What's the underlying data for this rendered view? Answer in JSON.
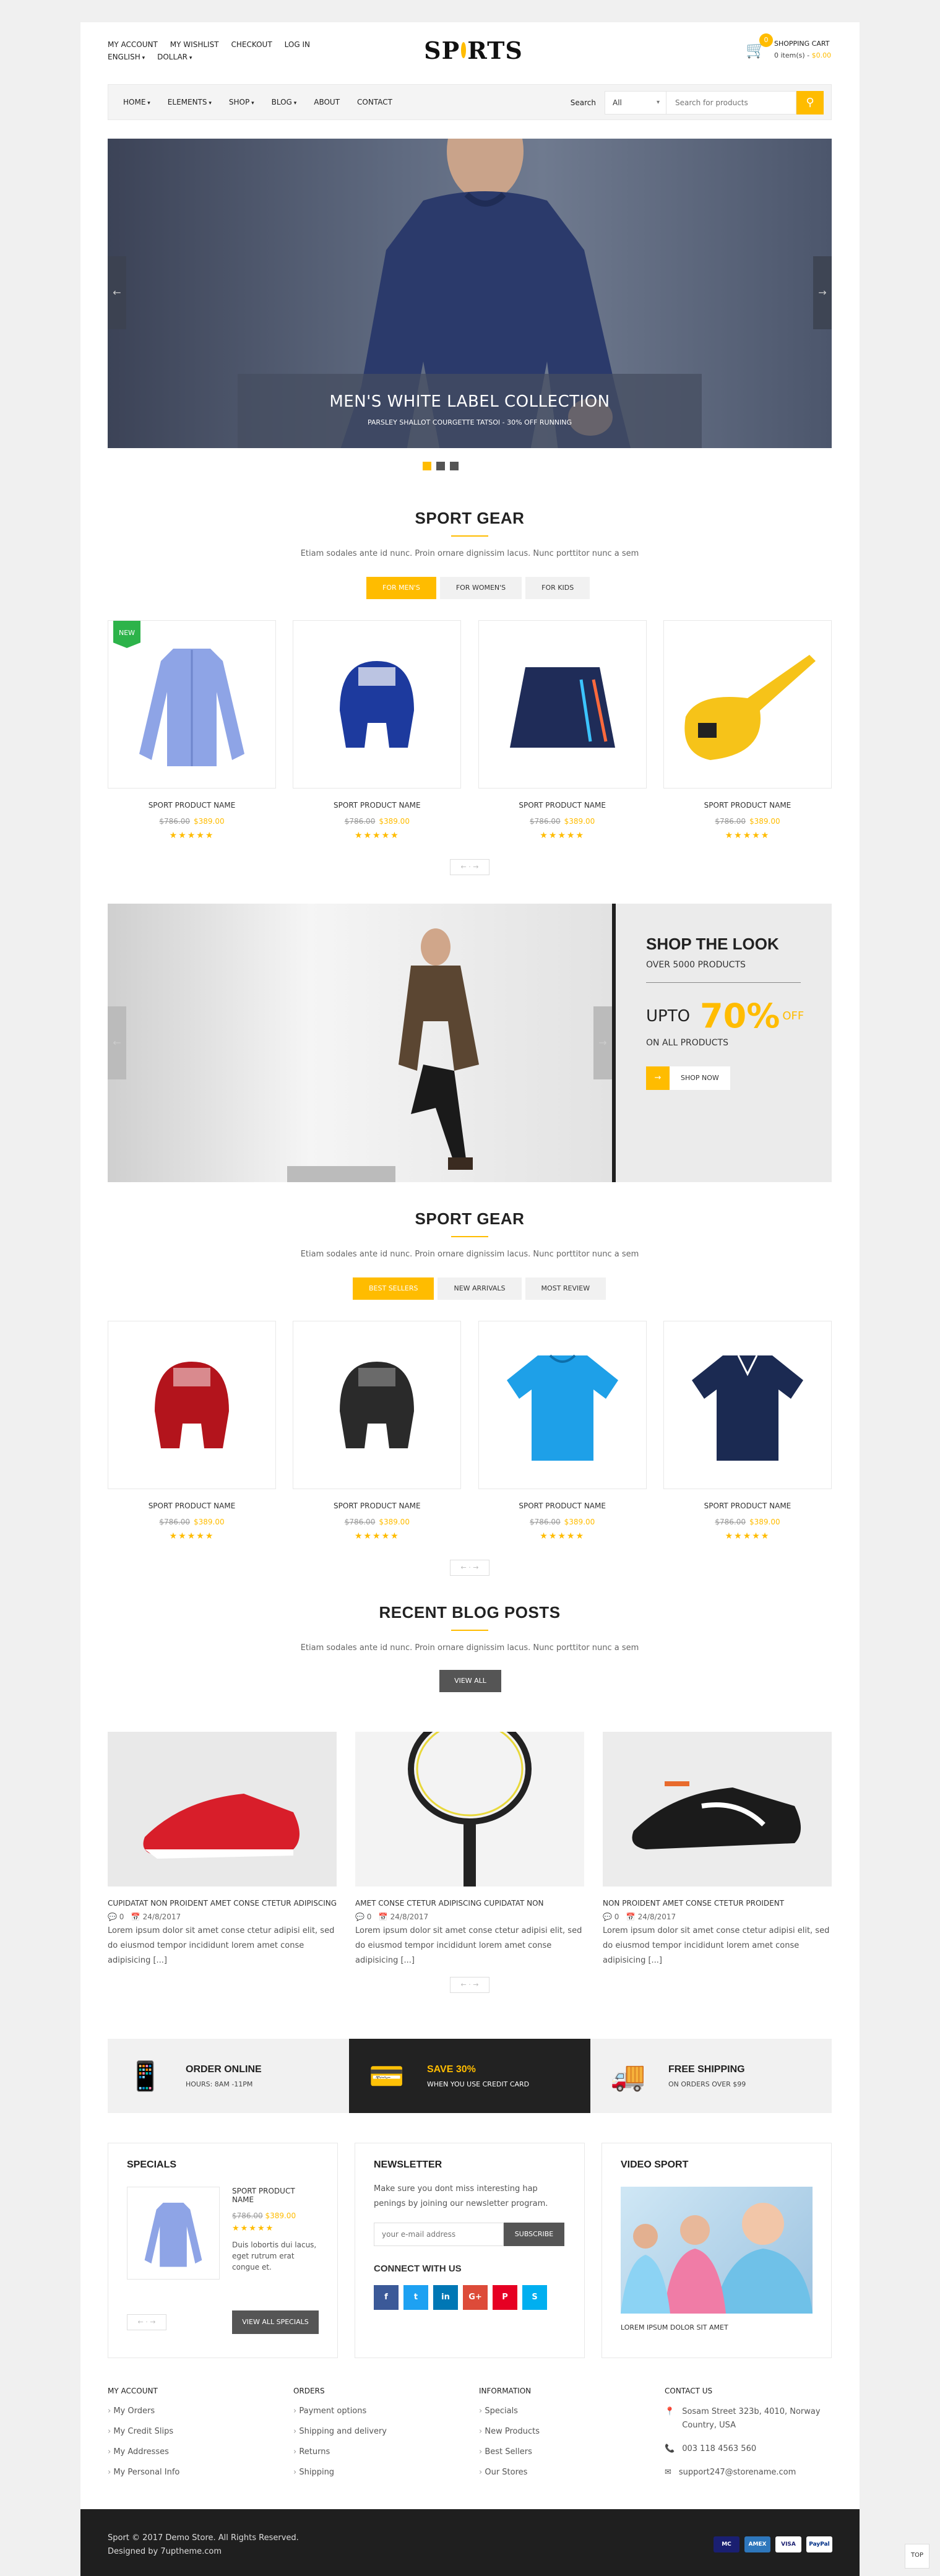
{
  "header": {
    "links": [
      "My Account",
      "My Wishlist",
      "Checkout",
      "Log in"
    ],
    "language": "English",
    "currency": "Dollar",
    "logo": "SPORTS",
    "cart_label": "Shopping Cart",
    "cart_count": "0",
    "cart_items": "0 item(s) -",
    "cart_total": "$0.00"
  },
  "menu": {
    "items": [
      "Home",
      "Elements",
      "Shop",
      "Blog",
      "About",
      "Contact"
    ],
    "search_label": "Search",
    "search_category": "All",
    "search_placeholder": "Search for products"
  },
  "hero": {
    "title": "MEN'S WHITE LABEL COLLECTION",
    "subtitle": "PARSLEY SHALLOT COURGETTE TATSOI - 30% OFF RUNNING"
  },
  "sport_gear_1": {
    "title": "SPORT GEAR",
    "desc": "Etiam sodales ante id nunc. Proin ornare dignissim lacus. Nunc porttitor nunc a sem",
    "tabs": [
      "For Men's",
      "For Women's",
      "For Kids"
    ],
    "new_badge": "NEW",
    "products": [
      {
        "name": "Sport Product Name",
        "old": "$786.00",
        "price": "$389.00"
      },
      {
        "name": "Sport Product Name",
        "old": "$786.00",
        "price": "$389.00"
      },
      {
        "name": "Sport Product Name",
        "old": "$786.00",
        "price": "$389.00"
      },
      {
        "name": "Sport Product Name",
        "old": "$786.00",
        "price": "$389.00"
      }
    ]
  },
  "shop_look": {
    "title": "SHOP THE LOOK",
    "sub": "OVER 5000 PRODUCTS",
    "upto": "UPTO",
    "percent": "70",
    "pct_sign": "%",
    "off": "OFF",
    "all": "ON ALL PRODUCTS",
    "button": "SHOP NOW"
  },
  "sport_gear_2": {
    "title": "SPORT GEAR",
    "desc": "Etiam sodales ante id nunc. Proin ornare dignissim lacus. Nunc porttitor nunc a sem",
    "tabs": [
      "Best Sellers",
      "New Arrivals",
      "Most Review"
    ],
    "products": [
      {
        "name": "Sport Product Name",
        "old": "$786.00",
        "price": "$389.00"
      },
      {
        "name": "Sport Product Name",
        "old": "$786.00",
        "price": "$389.00"
      },
      {
        "name": "Sport Product Name",
        "old": "$786.00",
        "price": "$389.00"
      },
      {
        "name": "Sport Product Name",
        "old": "$786.00",
        "price": "$389.00"
      }
    ]
  },
  "blog": {
    "title": "RECENT BLOG POSTS",
    "desc": "Etiam sodales ante id nunc. Proin ornare dignissim lacus. Nunc porttitor nunc a sem",
    "button": "VIEW ALL",
    "posts": [
      {
        "title": "Cupidatat non proident amet conse ctetur adipiscing",
        "comments": "0",
        "date": "24/8/2017",
        "excerpt": "Lorem ipsum dolor sit amet conse ctetur adipisi elit, sed do eiusmod tempor incididunt lorem amet conse adipisicing [...]"
      },
      {
        "title": "Amet conse ctetur adipiscing cupidatat non",
        "comments": "0",
        "date": "24/8/2017",
        "excerpt": "Lorem ipsum dolor sit amet conse ctetur adipisi elit, sed do eiusmod tempor incididunt lorem amet conse adipisicing [...]"
      },
      {
        "title": "Non proident amet conse ctetur proident",
        "comments": "0",
        "date": "24/8/2017",
        "excerpt": "Lorem ipsum dolor sit amet conse ctetur adipisi elit, sed do eiusmod tempor incididunt lorem amet conse adipisicing [...]"
      }
    ]
  },
  "services": [
    {
      "title": "ORDER ONLINE",
      "sub": "HOURS: 8AM -11PM"
    },
    {
      "title": "SAVE 30%",
      "sub": "WHEN YOU USE CREDIT CARD"
    },
    {
      "title": "FREE SHIPPING",
      "sub": "ON ORDERS OVER $99"
    }
  ],
  "specials": {
    "title": "SPECIALS",
    "name": "Sport Product Name",
    "old": "$786.00",
    "price": "$389.00",
    "desc": "Duis lobortis dui lacus, eget rutrum erat congue et.",
    "button": "VIEW ALL SPECIALS"
  },
  "newsletter": {
    "title": "NEWSLETTER",
    "desc": "Make sure you dont miss interesting hap penings by joining our newsletter program.",
    "placeholder": "your e-mail address",
    "button": "SUBSCRIBE",
    "connect": "CONNECT WITH US"
  },
  "video": {
    "title": "VIDEO SPORT",
    "caption": "LOREM IPSUM DOLOR SIT AMET"
  },
  "footer": {
    "cols": [
      {
        "title": "My Account",
        "items": [
          "My Orders",
          "My Credit Slips",
          "My Addresses",
          "My Personal Info"
        ]
      },
      {
        "title": "Orders",
        "items": [
          "Payment options",
          "Shipping and delivery",
          "Returns",
          "Shipping"
        ]
      },
      {
        "title": "Information",
        "items": [
          "Specials",
          "New Products",
          "Best Sellers",
          "Our Stores"
        ]
      }
    ],
    "contact_title": "Contact Us",
    "address": "Sosam Street 323b, 4010, Norway Country, USA",
    "phone": "003 118 4563 560",
    "email": "support247@storename.com",
    "copyright": "Sport © 2017 Demo Store. All Rights Reserved.",
    "designed": "Designed by 7uptheme.com",
    "cards": [
      "MC",
      "AMEX",
      "VISA",
      "PayPal"
    ],
    "top": "TOP"
  },
  "colors": {
    "accent": "#ffbc00",
    "dark": "#222222"
  }
}
